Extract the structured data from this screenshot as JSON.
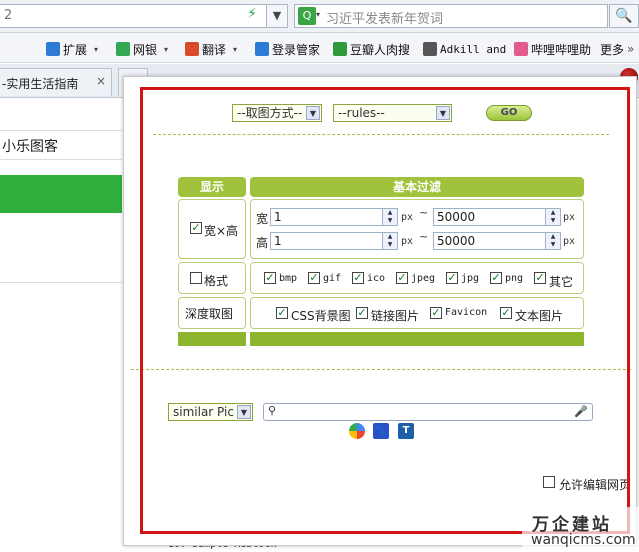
{
  "browser": {
    "url_fragment": "2",
    "search_placeholder": "习近平发表新年贺词",
    "bookmarks": [
      {
        "label": "扩展",
        "icon": "puzzle-icon",
        "color": "#2e7bd6",
        "mono": false,
        "caret": true
      },
      {
        "label": "网银",
        "icon": "shield-icon",
        "color": "#34a853",
        "mono": false,
        "caret": true
      },
      {
        "label": "翻译",
        "icon": "translate-icon",
        "color": "#d94b2b",
        "mono": false,
        "caret": true
      },
      {
        "label": "登录管家",
        "icon": "key-icon",
        "color": "#2e7bd6",
        "mono": false,
        "caret": false
      },
      {
        "label": "豆瓣人肉搜",
        "icon": "douban-icon",
        "color": "#2f9a3c",
        "mono": false,
        "caret": false
      },
      {
        "label": "Adkill and",
        "icon": "adkill-icon",
        "color": "#555555",
        "mono": true,
        "caret": false
      },
      {
        "label": "哔哩哔哩助",
        "icon": "bilibili-icon",
        "color": "#e05b8e",
        "mono": false,
        "caret": false
      },
      {
        "label": "更多",
        "icon": "more-icon",
        "color": "#888888",
        "mono": false,
        "caret": false
      }
    ],
    "more_arrow": "»",
    "tab_title": "-实用生活指南",
    "tab_close": "×"
  },
  "background_page": {
    "site_title": "小乐图客",
    "bottom_text": "10. Simple Adblock"
  },
  "panel": {
    "method_select": "--取图方式--",
    "rules_select": "--rules--",
    "go_label": "GO",
    "headers": {
      "display": "显示",
      "basic_filter": "基本过滤"
    },
    "size": {
      "label": "宽×高",
      "checked": true,
      "width_label": "宽",
      "height_label": "高",
      "width_min": "1",
      "width_max": "50000",
      "height_min": "1",
      "height_max": "50000",
      "unit": "px",
      "tilde": "~"
    },
    "format": {
      "label": "格式",
      "checked": false,
      "types": [
        {
          "label": "bmp",
          "checked": true,
          "mono": true
        },
        {
          "label": "gif",
          "checked": true,
          "mono": true
        },
        {
          "label": "ico",
          "checked": true,
          "mono": true
        },
        {
          "label": "jpeg",
          "checked": true,
          "mono": true
        },
        {
          "label": "jpg",
          "checked": true,
          "mono": true
        },
        {
          "label": "png",
          "checked": true,
          "mono": true
        },
        {
          "label": "其它",
          "checked": true,
          "mono": false
        }
      ]
    },
    "deep": {
      "label": "深度取图",
      "options": [
        {
          "label": "CSS背景图",
          "checked": true
        },
        {
          "label": "链接图片",
          "checked": true
        },
        {
          "label": "Favicon",
          "checked": true
        },
        {
          "label": "文本图片",
          "checked": true
        }
      ]
    },
    "similar_select": "similar Pic",
    "engines": [
      "google-icon",
      "baidu-icon",
      "tineye-icon"
    ],
    "allow_edit_label": "允许编辑网页",
    "allow_edit_checked": false
  },
  "watermark": {
    "cn": "万企建站",
    "url": "wanqicms.com"
  },
  "colors": {
    "accent_green": "#a0c23c",
    "highlight_red": "#d11414"
  }
}
